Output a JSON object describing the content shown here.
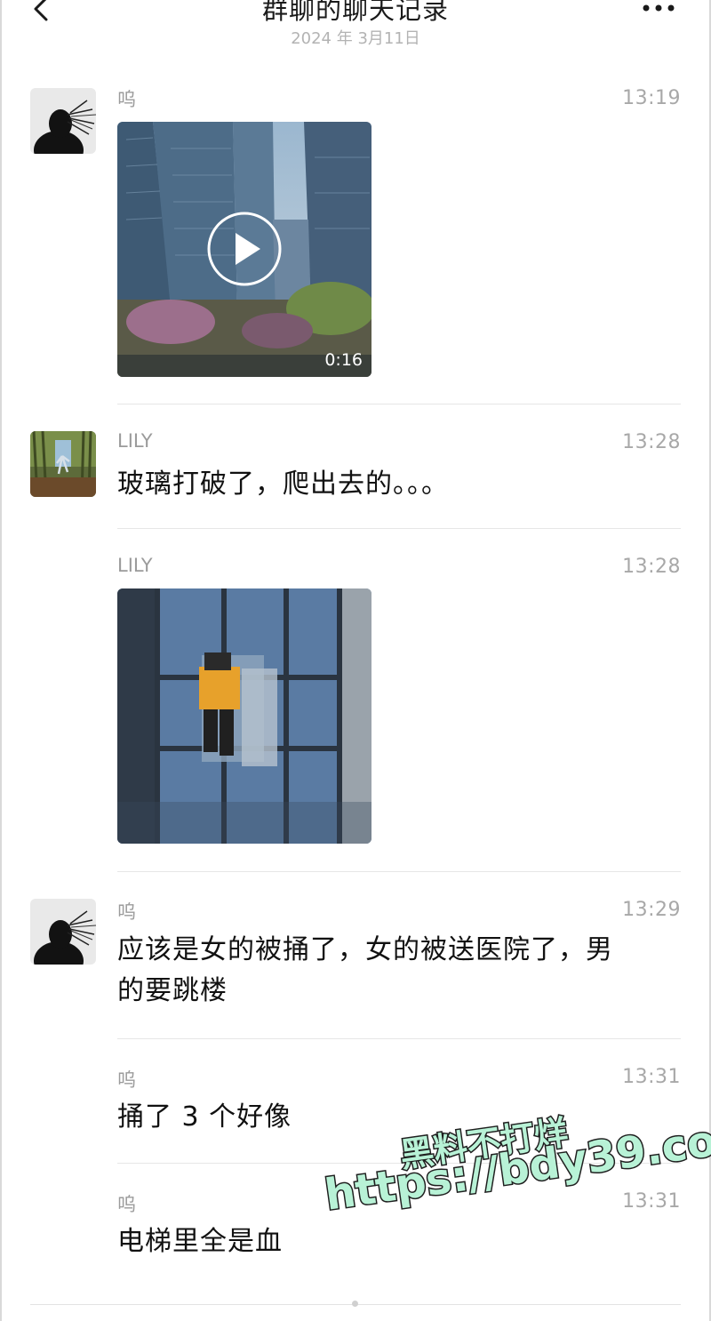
{
  "header": {
    "title": "群聊的聊天记录",
    "date": "2024 年 3月11日"
  },
  "messages": [
    {
      "sender": "呜",
      "time": "13:19",
      "type": "video",
      "duration": "0:16"
    },
    {
      "sender": "LILY",
      "time": "13:28",
      "type": "text",
      "text": "玻璃打破了，爬出去的。。。"
    },
    {
      "sender": "LILY",
      "time": "13:28",
      "type": "image"
    },
    {
      "sender": "呜",
      "time": "13:29",
      "type": "text",
      "text_line1": "应该是女的被捅了，女的被送医院了，男",
      "text_line2": "的要跳楼"
    },
    {
      "sender": "呜",
      "time": "13:31",
      "type": "text",
      "text": "捅了 3 个好像"
    },
    {
      "sender": "呜",
      "time": "13:31",
      "type": "text",
      "text": "电梯里全是血"
    }
  ],
  "watermark": {
    "line1": "黑料不打烊",
    "line2": "https://bdy39.co"
  },
  "colors": {
    "meta_text": "#a8a8a8",
    "divider": "#e6e6e6",
    "watermark_fill": "#b8f2d6"
  }
}
